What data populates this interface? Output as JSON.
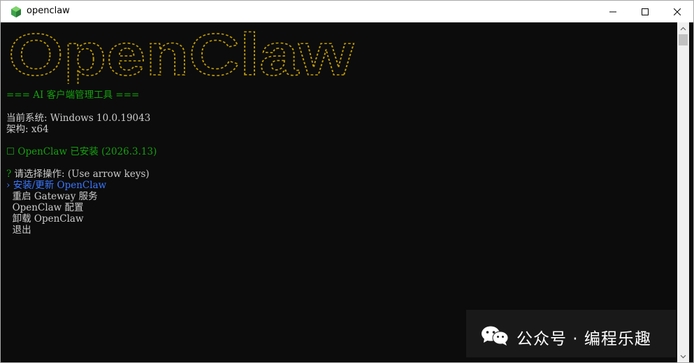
{
  "window": {
    "title": "openclaw",
    "icon": "green-cube-icon",
    "controls": [
      "minimize-icon",
      "maximize-icon",
      "close-icon"
    ]
  },
  "console": {
    "logo_text": "OpenClaw",
    "logo_color": "#c19c00",
    "header": "=== AI 客户端管理工具 ===",
    "system_line": "当前系统: Windows 10.0.19043",
    "arch_line": "架构: x64",
    "installed_status": "☐ OpenClaw 已安装 (2026.3.13)",
    "prompt_mark": "?",
    "prompt_text": " 请选择操作: (Use arrow keys)",
    "menu_pointer": "›",
    "menu": [
      {
        "label": "安装/更新 OpenClaw",
        "selected": true
      },
      {
        "label": "重启 Gateway 服务",
        "selected": false
      },
      {
        "label": "OpenClaw 配置",
        "selected": false
      },
      {
        "label": "卸载 OpenClaw",
        "selected": false
      },
      {
        "label": "退出",
        "selected": false
      }
    ]
  },
  "watermark": {
    "icon": "wechat-icon",
    "text": "公众号 · 编程乐趣"
  },
  "colors": {
    "terminal_bg": "#0c0c0c",
    "green": "#13a10e",
    "blue": "#3b78ff",
    "text": "#cccccc"
  }
}
